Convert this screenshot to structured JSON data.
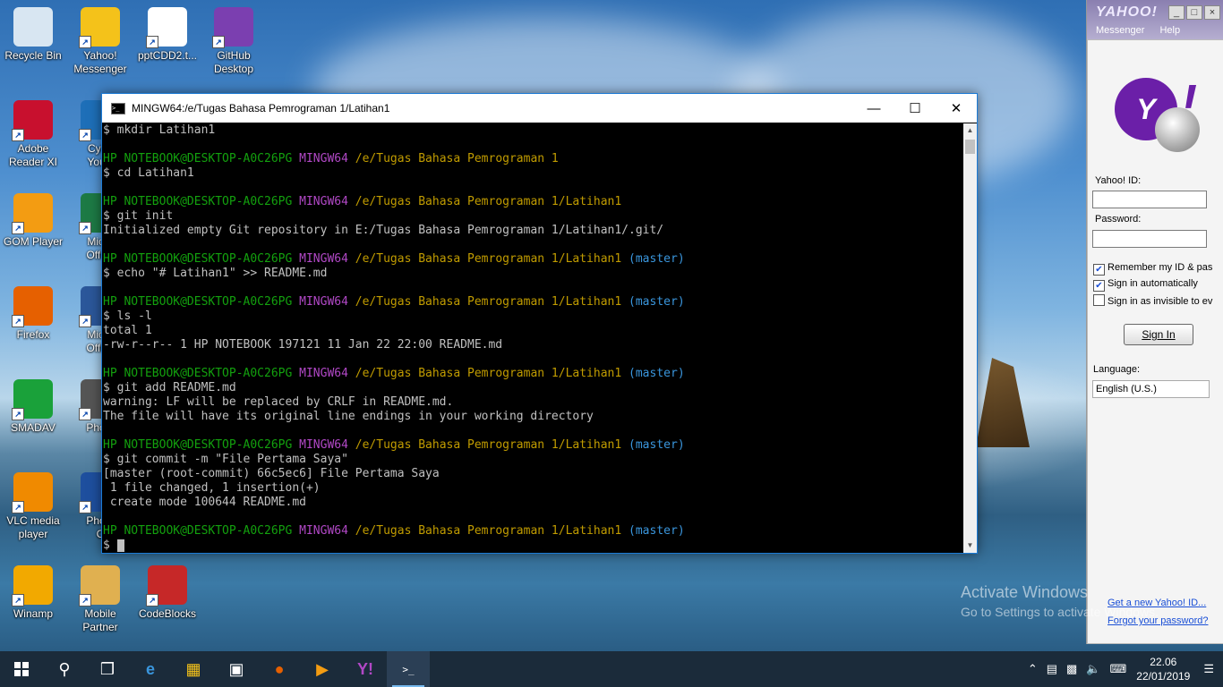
{
  "desktop_icons": [
    {
      "label": "Recycle Bin",
      "icon": "recycle-bin-icon",
      "color": "#d8e6f2"
    },
    {
      "label": "Yahoo!\nMessenger",
      "icon": "yahoo-messenger-icon",
      "color": "#f4c21a"
    },
    {
      "label": "pptCDD2.t...",
      "icon": "document-file-icon",
      "color": "#ffffff"
    },
    {
      "label": "GitHub\nDesktop",
      "icon": "github-desktop-icon",
      "color": "#7b3fb0"
    },
    {
      "label": "Adobe\nReader XI",
      "icon": "adobe-reader-icon",
      "color": "#c8102e"
    },
    {
      "label": "Cybe\nYouC",
      "icon": "cyberlink-youcam-icon",
      "color": "#1e6fb8"
    },
    {
      "label": "GOM Player",
      "icon": "gom-player-icon",
      "color": "#f39c12"
    },
    {
      "label": "Micro\nOffice",
      "icon": "ms-office-excel-icon",
      "color": "#1d7a45"
    },
    {
      "label": "Firefox",
      "icon": "firefox-icon",
      "color": "#e66000"
    },
    {
      "label": "Micro\nOffice",
      "icon": "ms-office-word-icon",
      "color": "#2b579a"
    },
    {
      "label": "SMADAV",
      "icon": "smadav-icon",
      "color": "#1aa13a"
    },
    {
      "label": "Photo",
      "icon": "photoscape-icon",
      "color": "#555555"
    },
    {
      "label": "VLC media\nplayer",
      "icon": "vlc-icon",
      "color": "#f08a00"
    },
    {
      "label": "Photo\nC",
      "icon": "photoshop-icon",
      "color": "#1e4f9e"
    },
    {
      "label": "Winamp",
      "icon": "winamp-icon",
      "color": "#f2a900"
    },
    {
      "label": "Mobile\nPartner",
      "icon": "mobile-partner-icon",
      "color": "#e0b050"
    },
    {
      "label": "CodeBlocks",
      "icon": "codeblocks-icon",
      "color": "#c62828"
    }
  ],
  "terminal": {
    "title": "MINGW64:/e/Tugas Bahasa Pemrograman 1/Latihan1",
    "lines": [
      [
        {
          "t": "$ mkdir Latihan1",
          "c": ""
        }
      ],
      [
        {
          "t": "",
          "c": ""
        }
      ],
      [
        {
          "t": "HP NOTEBOOK@DESKTOP-A0C26PG ",
          "c": "g"
        },
        {
          "t": "MINGW64 ",
          "c": "m"
        },
        {
          "t": "/e/Tugas Bahasa Pemrograman 1",
          "c": "y"
        }
      ],
      [
        {
          "t": "$ cd Latihan1",
          "c": ""
        }
      ],
      [
        {
          "t": "",
          "c": ""
        }
      ],
      [
        {
          "t": "HP NOTEBOOK@DESKTOP-A0C26PG ",
          "c": "g"
        },
        {
          "t": "MINGW64 ",
          "c": "m"
        },
        {
          "t": "/e/Tugas Bahasa Pemrograman 1/Latihan1",
          "c": "y"
        }
      ],
      [
        {
          "t": "$ git init",
          "c": ""
        }
      ],
      [
        {
          "t": "Initialized empty Git repository in E:/Tugas Bahasa Pemrograman 1/Latihan1/.git/",
          "c": ""
        }
      ],
      [
        {
          "t": "",
          "c": ""
        }
      ],
      [
        {
          "t": "HP NOTEBOOK@DESKTOP-A0C26PG ",
          "c": "g"
        },
        {
          "t": "MINGW64 ",
          "c": "m"
        },
        {
          "t": "/e/Tugas Bahasa Pemrograman 1/Latihan1 ",
          "c": "y"
        },
        {
          "t": "(master)",
          "c": "c"
        }
      ],
      [
        {
          "t": "$ echo \"# Latihan1\" >> README.md",
          "c": ""
        }
      ],
      [
        {
          "t": "",
          "c": ""
        }
      ],
      [
        {
          "t": "HP NOTEBOOK@DESKTOP-A0C26PG ",
          "c": "g"
        },
        {
          "t": "MINGW64 ",
          "c": "m"
        },
        {
          "t": "/e/Tugas Bahasa Pemrograman 1/Latihan1 ",
          "c": "y"
        },
        {
          "t": "(master)",
          "c": "c"
        }
      ],
      [
        {
          "t": "$ ls -l",
          "c": ""
        }
      ],
      [
        {
          "t": "total 1",
          "c": ""
        }
      ],
      [
        {
          "t": "-rw-r--r-- 1 HP NOTEBOOK 197121 11 Jan 22 22:00 README.md",
          "c": ""
        }
      ],
      [
        {
          "t": "",
          "c": ""
        }
      ],
      [
        {
          "t": "HP NOTEBOOK@DESKTOP-A0C26PG ",
          "c": "g"
        },
        {
          "t": "MINGW64 ",
          "c": "m"
        },
        {
          "t": "/e/Tugas Bahasa Pemrograman 1/Latihan1 ",
          "c": "y"
        },
        {
          "t": "(master)",
          "c": "c"
        }
      ],
      [
        {
          "t": "$ git add README.md",
          "c": ""
        }
      ],
      [
        {
          "t": "warning: LF will be replaced by CRLF in README.md.",
          "c": ""
        }
      ],
      [
        {
          "t": "The file will have its original line endings in your working directory",
          "c": ""
        }
      ],
      [
        {
          "t": "",
          "c": ""
        }
      ],
      [
        {
          "t": "HP NOTEBOOK@DESKTOP-A0C26PG ",
          "c": "g"
        },
        {
          "t": "MINGW64 ",
          "c": "m"
        },
        {
          "t": "/e/Tugas Bahasa Pemrograman 1/Latihan1 ",
          "c": "y"
        },
        {
          "t": "(master)",
          "c": "c"
        }
      ],
      [
        {
          "t": "$ git commit -m \"File Pertama Saya\"",
          "c": ""
        }
      ],
      [
        {
          "t": "[master (root-commit) 66c5ec6] File Pertama Saya",
          "c": ""
        }
      ],
      [
        {
          "t": " 1 file changed, 1 insertion(+)",
          "c": ""
        }
      ],
      [
        {
          "t": " create mode 100644 README.md",
          "c": ""
        }
      ],
      [
        {
          "t": "",
          "c": ""
        }
      ],
      [
        {
          "t": "HP NOTEBOOK@DESKTOP-A0C26PG ",
          "c": "g"
        },
        {
          "t": "MINGW64 ",
          "c": "m"
        },
        {
          "t": "/e/Tugas Bahasa Pemrograman 1/Latihan1 ",
          "c": "y"
        },
        {
          "t": "(master)",
          "c": "c"
        }
      ],
      [
        {
          "t": "$ ",
          "c": ""
        }
      ]
    ]
  },
  "yahoo": {
    "logo": "YAHOO!",
    "menu": [
      "Messenger",
      "Help"
    ],
    "id_label": "Yahoo! ID:",
    "password_label": "Password:",
    "remember": "Remember my ID & pas",
    "auto": "Sign in automatically",
    "invisible": "Sign in as invisible to ev",
    "signin": "Sign In",
    "language_label": "Language:",
    "language_value": "English (U.S.)",
    "link_new": "Get a new Yahoo! ID...",
    "link_forgot": "Forgot your password?"
  },
  "activate": {
    "line1": "Activate Windows",
    "line2": "Go to Settings to activate Windows."
  },
  "taskbar": {
    "time": "22.06",
    "date": "22/01/2019"
  },
  "colors": {
    "prompt_user": "#13a10e",
    "prompt_mingw": "#b148c6",
    "prompt_path": "#c19c00",
    "prompt_branch": "#3a96dd"
  }
}
